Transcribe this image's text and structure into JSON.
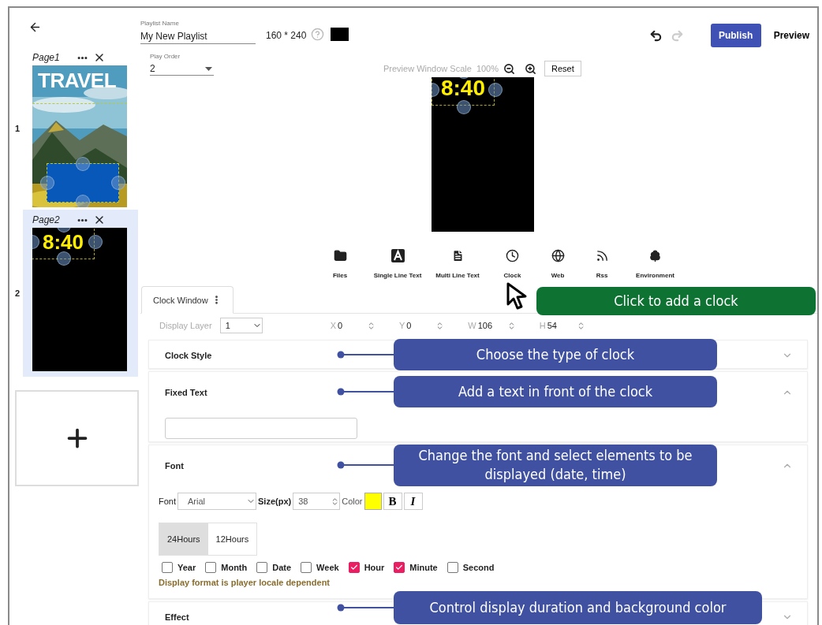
{
  "header": {
    "playlist_name_label": "Playlist Name",
    "playlist_name": "My New Playlist",
    "resolution": "160 * 240",
    "publish": "Publish",
    "preview": "Preview",
    "undo_enabled": true,
    "redo_enabled": false
  },
  "play_order": {
    "label": "Play Order",
    "value": "2"
  },
  "preview": {
    "scale_label": "Preview Window Scale",
    "scale": "100%",
    "reset": "Reset",
    "clock_text": "8:40"
  },
  "pages": [
    {
      "number": "1",
      "name": "Page1",
      "selected": false,
      "kind": "picture",
      "title": "TRAVEL"
    },
    {
      "number": "2",
      "name": "Page2",
      "selected": true,
      "kind": "clock",
      "clock_text": "8:40"
    }
  ],
  "widgets": [
    {
      "kind": "files",
      "label": "Files"
    },
    {
      "kind": "single_text",
      "label": "Single Line Text"
    },
    {
      "kind": "multi_text",
      "label": "Multi Line Text"
    },
    {
      "kind": "clock",
      "label": "Clock"
    },
    {
      "kind": "web",
      "label": "Web"
    },
    {
      "kind": "rss",
      "label": "Rss"
    },
    {
      "kind": "environment",
      "label": "Environment"
    }
  ],
  "tab": {
    "label": "Clock Window"
  },
  "position": {
    "layer_label": "Display Layer",
    "layer": "1",
    "fields": [
      {
        "label": "X",
        "value": "0"
      },
      {
        "label": "Y",
        "value": "0"
      },
      {
        "label": "W",
        "value": "106"
      },
      {
        "label": "H",
        "value": "54"
      }
    ]
  },
  "sections": [
    {
      "kind": "clock_style",
      "title": "Clock Style",
      "expanded": false
    },
    {
      "kind": "fixed_text",
      "title": "Fixed Text",
      "expanded": true
    },
    {
      "kind": "font",
      "title": "Font",
      "expanded": true
    },
    {
      "kind": "effect",
      "title": "Effect",
      "expanded": false
    }
  ],
  "font": {
    "label": "Font",
    "family": "Arial",
    "size_label": "Size(px)",
    "size": "38",
    "color_label": "Color",
    "bold": "B",
    "italic": "I"
  },
  "hour_modes": [
    {
      "label": "24Hours",
      "selected": true
    },
    {
      "label": "12Hours",
      "selected": false
    }
  ],
  "elements": [
    {
      "label": "Year",
      "checked": false
    },
    {
      "label": "Month",
      "checked": false
    },
    {
      "label": "Date",
      "checked": false
    },
    {
      "label": "Week",
      "checked": false
    },
    {
      "label": "Hour",
      "checked": true
    },
    {
      "label": "Minute",
      "checked": true
    },
    {
      "label": "Second",
      "checked": false
    }
  ],
  "note": "Display format is player locale dependent",
  "callouts": [
    {
      "kind": "box",
      "text": "Click to add a clock",
      "color": "#0e7332"
    },
    {
      "kind": "pointer",
      "text": "Choose the type of clock",
      "color": "#3f51a0"
    },
    {
      "kind": "pointer",
      "text": "Add a text in front of the clock",
      "color": "#3f51a0"
    },
    {
      "kind": "pointer",
      "text": "Change the font and select elements to be displayed (date, time)",
      "color": "#3f51a0"
    },
    {
      "kind": "pointer",
      "text": "Control display duration and background color",
      "color": "#3f51a0"
    }
  ]
}
